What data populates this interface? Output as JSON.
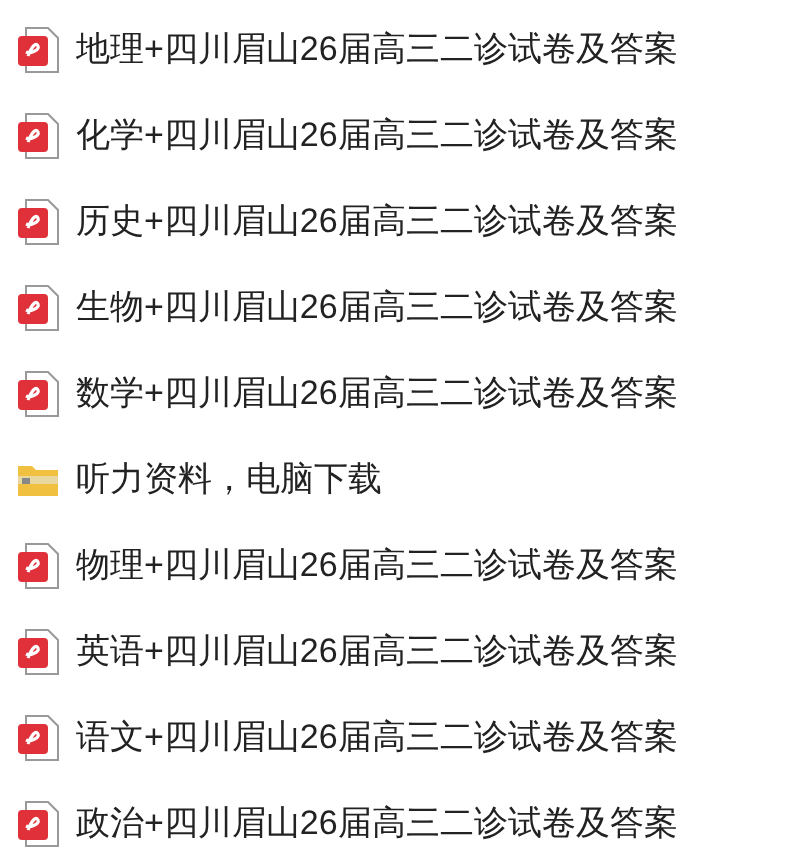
{
  "files": [
    {
      "kind": "pdf",
      "name": "地理+四川眉山26届高三二诊试卷及答案"
    },
    {
      "kind": "pdf",
      "name": "化学+四川眉山26届高三二诊试卷及答案"
    },
    {
      "kind": "pdf",
      "name": "历史+四川眉山26届高三二诊试卷及答案"
    },
    {
      "kind": "pdf",
      "name": "生物+四川眉山26届高三二诊试卷及答案"
    },
    {
      "kind": "pdf",
      "name": "数学+四川眉山26届高三二诊试卷及答案"
    },
    {
      "kind": "zip",
      "name": "听力资料，电脑下载"
    },
    {
      "kind": "pdf",
      "name": "物理+四川眉山26届高三二诊试卷及答案"
    },
    {
      "kind": "pdf",
      "name": "英语+四川眉山26届高三二诊试卷及答案"
    },
    {
      "kind": "pdf",
      "name": "语文+四川眉山26届高三二诊试卷及答案"
    },
    {
      "kind": "pdf",
      "name": "政治+四川眉山26届高三二诊试卷及答案"
    }
  ]
}
